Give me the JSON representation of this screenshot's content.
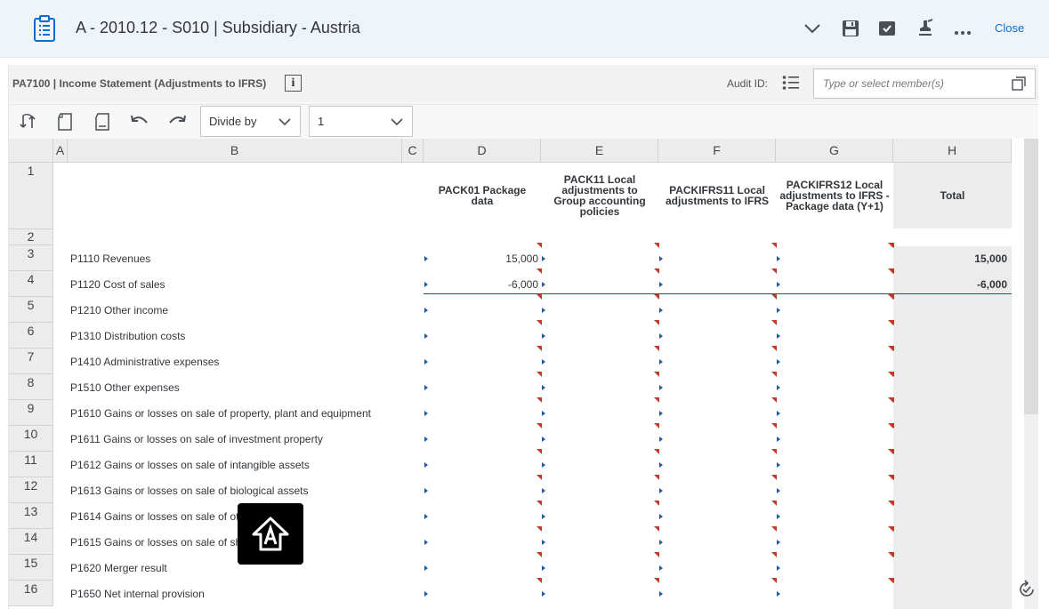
{
  "header": {
    "title": "A - 2010.12 - S010 | Subsidiary - Austria",
    "close_label": "Close",
    "icons": [
      "clipboard-icon",
      "chevron-down-icon",
      "save-icon",
      "checkbox-icon",
      "stamp-icon",
      "more-icon"
    ]
  },
  "infobar": {
    "report_title": "PA7100 | Income Statement (Adjustments to IFRS)",
    "info_glyph": "i",
    "audit_label": "Audit ID:",
    "member_placeholder": "Type or select member(s)"
  },
  "toolbar": {
    "divide_by_label": "Divide by",
    "scale_value": "1"
  },
  "grid": {
    "columns": [
      "A",
      "B",
      "C",
      "D",
      "E",
      "F",
      "G",
      "H"
    ],
    "headers": {
      "D": "PACK01 Package data",
      "E": "PACK11 Local adjustments to Group accounting policies",
      "F": "PACKIFRS11 Local adjustments to IFRS",
      "G": "PACKIFRS12 Local adjustments to IFRS - Package data (Y+1)",
      "H": "Total"
    },
    "row_numbers": [
      "1",
      "2",
      "3",
      "4",
      "5",
      "6",
      "7",
      "8",
      "9",
      "10",
      "11",
      "12",
      "13",
      "14",
      "15",
      "16"
    ],
    "rows": [
      {
        "label": "P1110 Revenues",
        "D": "15,000",
        "H": "15,000"
      },
      {
        "label": "P1120 Cost of sales",
        "D": "-6,000",
        "H": "-6,000"
      },
      {
        "label": "P1210 Other income",
        "D": "",
        "H": ""
      },
      {
        "label": "P1310 Distribution costs",
        "D": "",
        "H": ""
      },
      {
        "label": "P1410 Administrative expenses",
        "D": "",
        "H": ""
      },
      {
        "label": "P1510 Other expenses",
        "D": "",
        "H": ""
      },
      {
        "label": "P1610 Gains or losses on sale of property, plant and equipment",
        "D": "",
        "H": ""
      },
      {
        "label": "P1611 Gains or losses on sale of investment property",
        "D": "",
        "H": ""
      },
      {
        "label": "P1612 Gains or losses on sale of intangible assets",
        "D": "",
        "H": ""
      },
      {
        "label": "P1613 Gains or losses on sale of biological assets",
        "D": "",
        "H": ""
      },
      {
        "label": "P1614 Gains or losses on sale of ot",
        "D": "",
        "H": ""
      },
      {
        "label": "P1615 Gains or losses on sale of sh",
        "D": "",
        "H": ""
      },
      {
        "label": "P1620 Merger result",
        "D": "",
        "H": ""
      },
      {
        "label": "P1650 Net internal provision",
        "D": "",
        "H": ""
      }
    ]
  },
  "colors": {
    "header_bg": "#eff4f9",
    "link": "#0a6ed1",
    "marker_red": "#c0392b",
    "marker_blue": "#1f5aa6",
    "total_bg": "#ececec"
  }
}
